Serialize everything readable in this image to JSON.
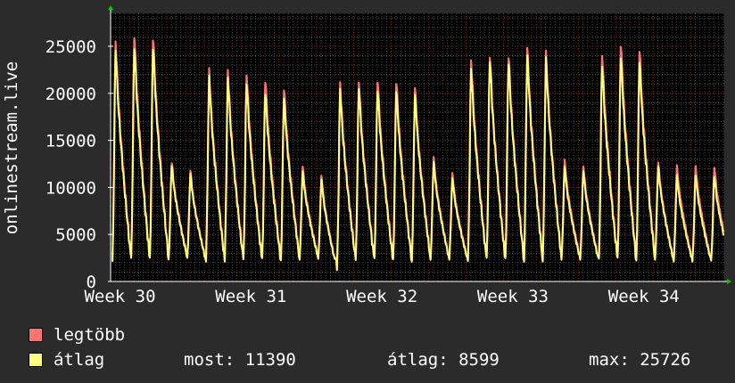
{
  "colors": {
    "background": "#2b2b2b",
    "plot_background": "#000000",
    "max_series": "#ff7373",
    "avg_series": "#ffff80",
    "text": "#ffffff",
    "grid": "#444444",
    "major_grid": "#7a1a1a"
  },
  "legend": {
    "max_label": "legtöbb",
    "avg_label": "átlag",
    "now": "most: 11390",
    "avg": "átlag: 8599",
    "max": "max: 25726"
  },
  "chart_data": {
    "type": "line",
    "ylabel": "onlinestream.live",
    "ylim": [
      0,
      28500
    ],
    "yticks": [
      0,
      5000,
      10000,
      15000,
      20000,
      25000
    ],
    "ytick_labels": [
      "0",
      "5000",
      "10000",
      "15000",
      "20000",
      "25000"
    ],
    "xlim": [
      0,
      32.8
    ],
    "xticks": [
      0.5,
      7.5,
      14.5,
      21.5,
      28.5
    ],
    "xtick_labels": [
      "Week 30",
      "Week 31",
      "Week 32",
      "Week 33",
      "Week 34"
    ],
    "days_x": [
      0.1,
      1.1,
      2.1,
      3.1,
      4.1,
      5.1,
      6.1,
      7.1,
      8.1,
      9.1,
      10.1,
      11.1,
      12.1,
      13.1,
      14.1,
      15.1,
      16.1,
      17.1,
      18.1,
      19.1,
      20.1,
      21.1,
      22.1,
      23.1,
      24.1,
      25.1,
      26.1,
      27.1,
      28.1,
      29.1,
      30.1,
      31.1,
      32.1
    ],
    "series": [
      {
        "name": "legtöbb",
        "daily_peak": [
          26000,
          26800,
          26700,
          12900,
          11900,
          22800,
          22800,
          22600,
          22000,
          21000,
          12400,
          11300,
          21400,
          21700,
          22000,
          21800,
          21000,
          13300,
          11600,
          24000,
          24700,
          24700,
          25500,
          24800,
          13000,
          12400,
          24800,
          26000,
          25200,
          12800,
          12400,
          12400,
          12400
        ],
        "daily_low": [
          2200,
          2200,
          2200,
          2400,
          2600,
          2200,
          2200,
          2200,
          2200,
          2200,
          2400,
          2500,
          1300,
          2200,
          2200,
          2200,
          2200,
          2400,
          2400,
          2200,
          2200,
          2200,
          2200,
          2200,
          2400,
          2400,
          2200,
          2200,
          2200,
          2400,
          2200,
          2200,
          2200
        ]
      },
      {
        "name": "átlag",
        "daily_peak": [
          25000,
          25600,
          25700,
          12600,
          11600,
          22000,
          22000,
          21600,
          20700,
          20100,
          11900,
          10900,
          20700,
          21000,
          21000,
          20900,
          20300,
          12800,
          11100,
          23100,
          24200,
          24000,
          24700,
          24100,
          12300,
          11900,
          23600,
          24700,
          24000,
          12400,
          11390,
          11390,
          11390
        ],
        "daily_low": [
          2100,
          2100,
          2100,
          2300,
          2500,
          2100,
          2100,
          2100,
          2100,
          2100,
          2300,
          2400,
          1200,
          2100,
          2100,
          2100,
          2100,
          2300,
          2300,
          2100,
          2100,
          2100,
          2100,
          2100,
          2300,
          2300,
          2100,
          2100,
          2100,
          2300,
          2100,
          2100,
          2100
        ]
      }
    ]
  }
}
